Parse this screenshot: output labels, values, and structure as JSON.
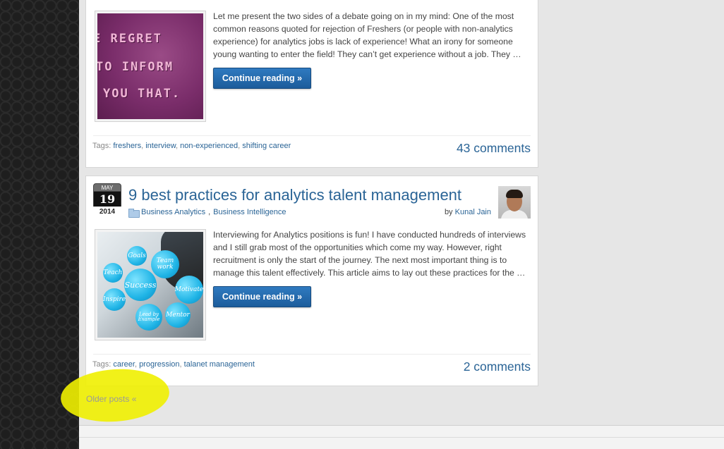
{
  "posts": [
    {
      "excerpt": "Let me present the two sides of a debate going on in my mind: One of the most common reasons quoted for rejection of Freshers (or people with non-analytics experience) for analytics jobs is lack of experience! What an irony for someone young wanting to enter the field! They can’t get experience without a job. They …",
      "continue_label": "Continue reading »",
      "tags_label": "Tags:",
      "tags": [
        "freshers",
        "interview",
        "non-experienced",
        "shifting career"
      ],
      "comments": "43 comments",
      "thumb_text": [
        "E REGRET",
        "TO INFORM",
        "YOU THAT."
      ]
    },
    {
      "date": {
        "month": "MAY",
        "day": "19",
        "year": "2014"
      },
      "title": "9 best practices for analytics talent management",
      "categories": [
        "Business Analytics",
        "Business Intelligence"
      ],
      "by_label": "by",
      "author": "Kunal Jain",
      "excerpt": "Interviewing for Analytics positions is fun! I have conducted hundreds of interviews and I still grab most of the opportunities which come my way. However, right recruitment is only the start of the journey. The next most important thing is to manage this talent effectively. This article aims to lay out these practices for the …",
      "continue_label": "Continue reading »",
      "tags_label": "Tags:",
      "tags": [
        "career",
        "progression",
        "talanet management"
      ],
      "comments": "2 comments",
      "bubbles": [
        "Goals",
        "Team work",
        "Teach",
        "Success",
        "Motivate",
        "Inspire",
        "Lead by Example",
        "Mentor"
      ]
    }
  ],
  "pagination": {
    "older_posts": "Older posts «"
  },
  "colors": {
    "link": "#2a6496",
    "button": "#1c5c9b",
    "highlight": "#f0f000"
  }
}
